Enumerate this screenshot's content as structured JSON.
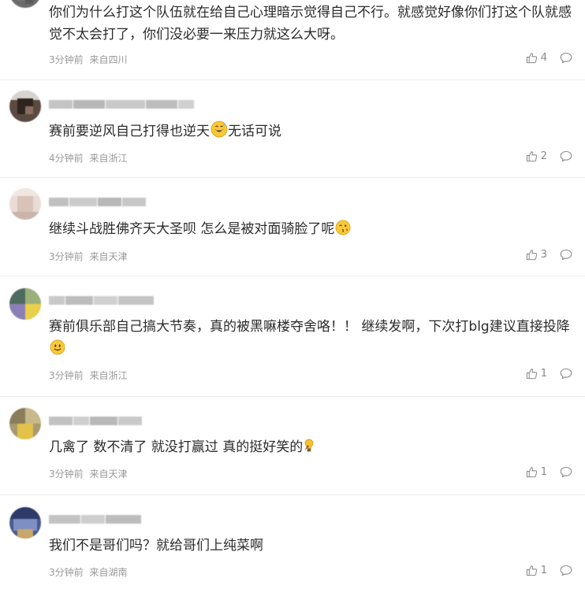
{
  "comments": [
    {
      "content": "你们为什么打这个队伍就在给自己心理暗示觉得自己不行。就感觉好像你们打这个队就感觉不太会打了，你们没必要一来压力就这么大呀。",
      "time": "3分钟前",
      "location": "来自四川",
      "likes": "4"
    },
    {
      "content": "赛前要逆风自己打得也逆天",
      "content_tail": "无话可说",
      "time": "4分钟前",
      "location": "来自浙江",
      "likes": "2"
    },
    {
      "content": "继续斗战胜佛齐天大圣呗 怎么是被对面骑脸了呢",
      "time": "3分钟前",
      "location": "来自天津",
      "likes": "3"
    },
    {
      "content": "赛前俱乐部自己搞大节奏，真的被黑嘛楼夺舍咯！！ 继续发啊，下次打blg建议直接投降",
      "time": "3分钟前",
      "location": "来自浙江",
      "likes": "1"
    },
    {
      "content": "几禽了 数不清了 就没打赢过 真的挺好笑的",
      "time": "3分钟前",
      "location": "来自天津",
      "likes": "1"
    },
    {
      "content": "我们不是哥们吗？就给哥们上纯菜啊",
      "time": "3分钟前",
      "location": "来自湖南",
      "likes": "1"
    }
  ],
  "icons": {
    "like": "thumbs-up-icon",
    "reply": "comment-bubble-icon"
  },
  "colors": {
    "meta_text": "#999999",
    "content_text": "#2b2b2b",
    "divider": "#ececec"
  }
}
